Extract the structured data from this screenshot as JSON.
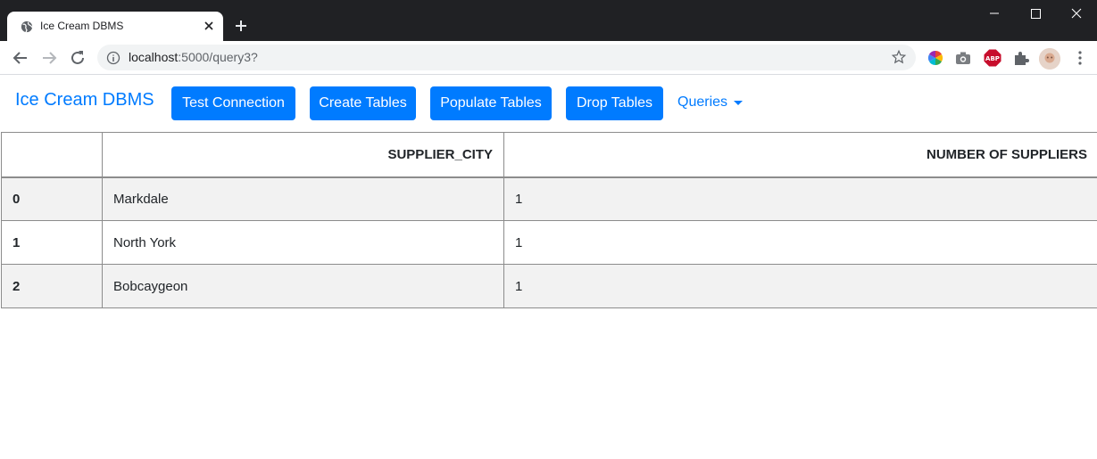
{
  "browser": {
    "tab_title": "Ice Cream DBMS",
    "url_host": "localhost",
    "url_path": ":5000/query3?"
  },
  "navbar": {
    "brand": "Ice Cream DBMS",
    "buttons": [
      "Test Connection",
      "Create Tables",
      "Populate Tables",
      "Drop Tables"
    ],
    "queries_label": "Queries"
  },
  "table": {
    "columns": [
      "",
      "SUPPLIER_CITY",
      "NUMBER OF SUPPLIERS"
    ],
    "rows": [
      {
        "index": "0",
        "city": "Markdale",
        "count": "1"
      },
      {
        "index": "1",
        "city": "North York",
        "count": "1"
      },
      {
        "index": "2",
        "city": "Bobcaygeon",
        "count": "1"
      }
    ]
  },
  "colors": {
    "primary": "#007bff",
    "chrome_dark": "#202124",
    "stripe": "#f2f2f2"
  }
}
